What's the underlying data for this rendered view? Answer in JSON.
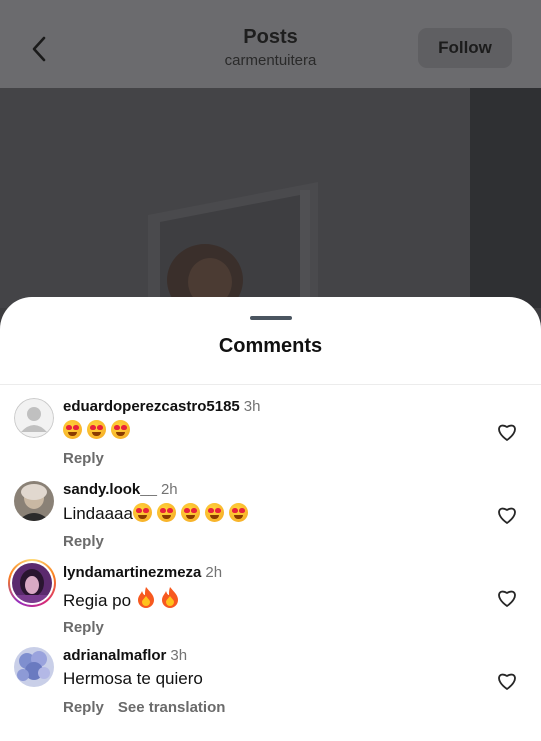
{
  "header": {
    "title": "Posts",
    "subtitle": "carmentuitera",
    "follow_label": "Follow"
  },
  "sheet": {
    "title": "Comments"
  },
  "comments": [
    {
      "username": "eduardoperezcastro5185",
      "time": "3h",
      "text": "",
      "emoji_count": 3,
      "reply_label": "Reply",
      "avatar": "default-avatar"
    },
    {
      "username": "sandy.look__",
      "time": "2h",
      "text": "Lindaaaa",
      "emoji_count": 5,
      "reply_label": "Reply",
      "avatar": "photo-avatar"
    },
    {
      "username": "lyndamartinezmeza",
      "time": "2h",
      "text": "Regia po",
      "fire_count": 2,
      "reply_label": "Reply",
      "avatar": "story-ring-avatar"
    },
    {
      "username": "adrianalmaflor",
      "time": "3h",
      "text": "Hermosa te quiero",
      "reply_label": "Reply",
      "translate_label": "See translation",
      "avatar": "flower-avatar"
    }
  ],
  "icons": {
    "back": "chevron-left-icon",
    "like": "heart-outline-icon",
    "emoji": "heart-eyes-emoji",
    "fire": "fire-emoji"
  }
}
